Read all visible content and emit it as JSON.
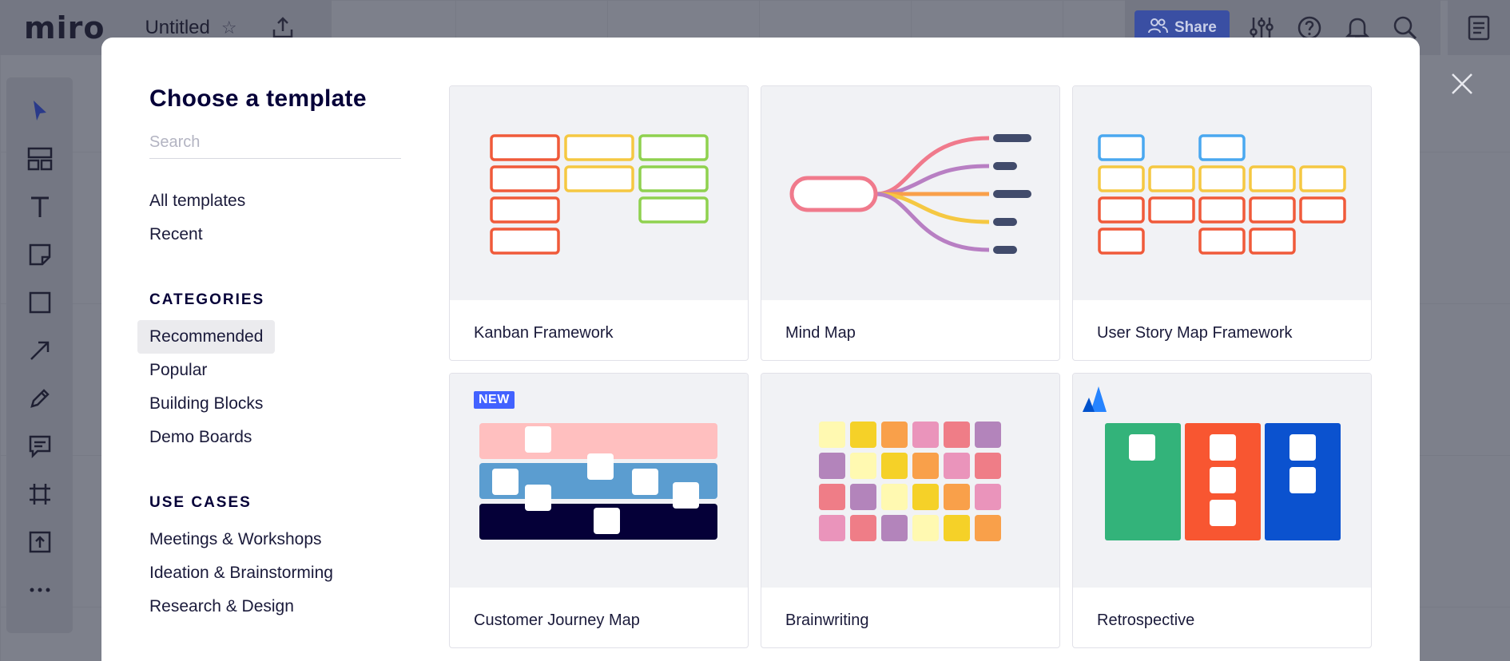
{
  "app": {
    "logo": "miro",
    "board_title": "Untitled",
    "share_label": "Share"
  },
  "modal": {
    "title": "Choose a template",
    "search_placeholder": "Search",
    "nav": [
      {
        "label": "All templates"
      },
      {
        "label": "Recent"
      }
    ],
    "categories_heading": "CATEGORIES",
    "categories": [
      {
        "label": "Recommended",
        "active": true
      },
      {
        "label": "Popular"
      },
      {
        "label": "Building Blocks"
      },
      {
        "label": "Demo Boards"
      }
    ],
    "use_cases_heading": "USE CASES",
    "use_cases": [
      {
        "label": "Meetings & Workshops"
      },
      {
        "label": "Ideation & Brainstorming"
      },
      {
        "label": "Research & Design"
      }
    ]
  },
  "templates": [
    {
      "label": "Kanban Framework"
    },
    {
      "label": "Mind Map"
    },
    {
      "label": "User Story Map Framework"
    },
    {
      "label": "Customer Journey Map",
      "badge": "NEW"
    },
    {
      "label": "Brainwriting"
    },
    {
      "label": "Retrospective"
    }
  ],
  "colors": {
    "accent": "#4262ff",
    "text": "#050038",
    "red": "#f05a3a",
    "yellow": "#f5c842",
    "green": "#8fd14f",
    "blue": "#4aa8f0",
    "navy": "#414b6b"
  }
}
